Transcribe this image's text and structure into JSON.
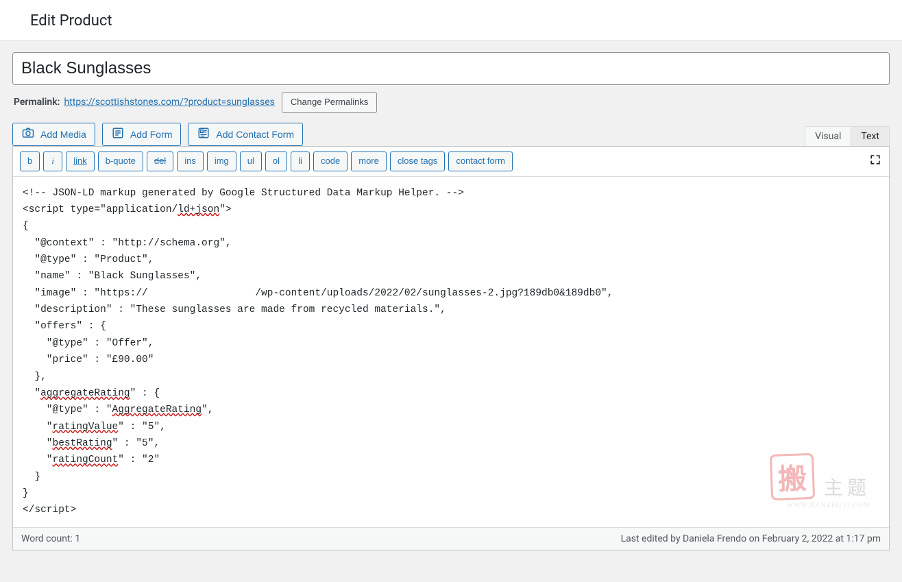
{
  "header": {
    "title": "Edit Product"
  },
  "post": {
    "title_value": "Black Sunglasses",
    "permalink_label": "Permalink:",
    "permalink_url": "https://scottishstones.com/?product=sunglasses",
    "change_permalinks": "Change Permalinks"
  },
  "media_row": {
    "add_media": "Add Media",
    "add_form": "Add Form",
    "add_contact_form": "Add Contact Form"
  },
  "tabs": {
    "visual": "Visual",
    "text": "Text"
  },
  "quicktags": {
    "b": "b",
    "i": "i",
    "link": "link",
    "bquote": "b-quote",
    "del": "del",
    "ins": "ins",
    "img": "img",
    "ul": "ul",
    "ol": "ol",
    "li": "li",
    "code": "code",
    "more": "more",
    "close": "close tags",
    "contact": "contact form"
  },
  "editor": {
    "lines": [
      "<!-- JSON-LD markup generated by Google Structured Data Markup Helper. -->",
      "<script type=\"application/ld+json\">",
      "{",
      "  \"@context\" : \"http://schema.org\",",
      "  \"@type\" : \"Product\",",
      "  \"name\" : \"Black Sunglasses\",",
      "  \"image\" : \"https://                  /wp-content/uploads/2022/02/sunglasses-2.jpg?189db0&189db0\",",
      "  \"description\" : \"These sunglasses are made from recycled materials.\",",
      "  \"offers\" : {",
      "    \"@type\" : \"Offer\",",
      "    \"price\" : \"£90.00\"",
      "  },",
      "  \"aggregateRating\" : {",
      "    \"@type\" : \"AggregateRating\",",
      "    \"ratingValue\" : \"5\",",
      "    \"bestRating\" : \"5\",",
      "    \"ratingCount\" : \"2\"",
      "  }",
      "}",
      "</script>"
    ],
    "spell_errors": [
      "ld+json",
      "aggregateRating",
      "AggregateRating",
      "ratingValue",
      "bestRating",
      "ratingCount"
    ]
  },
  "status": {
    "word_count_label": "Word count: 1",
    "last_edited": "Last edited by Daniela Frendo on February 2, 2022 at 1:17 pm"
  },
  "watermark": {
    "stamp": "搬",
    "text": "主题",
    "url": "WWW.BANZHUTI.COM"
  }
}
